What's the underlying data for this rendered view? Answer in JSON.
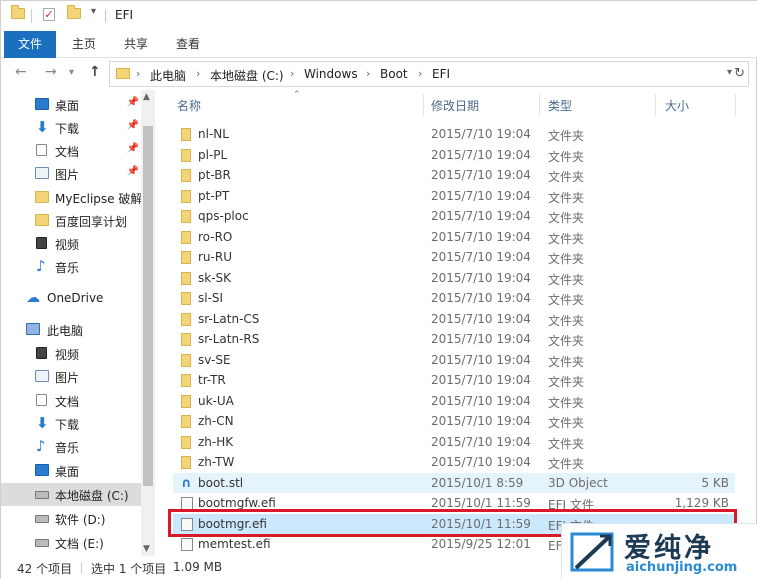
{
  "window": {
    "title": "EFI"
  },
  "ribbon": {
    "tabs": [
      {
        "label": "文件"
      },
      {
        "label": "主页"
      },
      {
        "label": "共享"
      },
      {
        "label": "查看"
      }
    ]
  },
  "address": {
    "crumbs": [
      "此电脑",
      "本地磁盘 (C:)",
      "Windows",
      "Boot",
      "EFI"
    ]
  },
  "navpane": {
    "items": [
      {
        "label": "桌面",
        "icon": "desktop-icon",
        "pinned": true
      },
      {
        "label": "下载",
        "icon": "download-icon",
        "pinned": true
      },
      {
        "label": "文档",
        "icon": "document-icon",
        "pinned": true
      },
      {
        "label": "图片",
        "icon": "pictures-icon",
        "pinned": true
      },
      {
        "label": "MyEclipse 破解",
        "icon": "folder-icon"
      },
      {
        "label": "百度回享计划",
        "icon": "folder-icon"
      },
      {
        "label": "视频",
        "icon": "video-icon"
      },
      {
        "label": "音乐",
        "icon": "music-icon"
      },
      {
        "label": "OneDrive",
        "icon": "onedrive-icon"
      },
      {
        "label": "此电脑",
        "icon": "this-pc-icon"
      },
      {
        "label": "视频",
        "icon": "video-icon"
      },
      {
        "label": "图片",
        "icon": "pictures-icon"
      },
      {
        "label": "文档",
        "icon": "document-icon"
      },
      {
        "label": "下载",
        "icon": "download-icon"
      },
      {
        "label": "音乐",
        "icon": "music-icon"
      },
      {
        "label": "桌面",
        "icon": "desktop-icon"
      },
      {
        "label": "本地磁盘 (C:)",
        "icon": "drive-icon",
        "selected": true
      },
      {
        "label": "软件 (D:)",
        "icon": "drive-icon"
      },
      {
        "label": "文档 (E:)",
        "icon": "drive-icon"
      }
    ]
  },
  "columns": {
    "name": "名称",
    "date": "修改日期",
    "type": "类型",
    "size": "大小"
  },
  "files": [
    {
      "name": "nl-NL",
      "date": "2015/7/10 19:04",
      "type": "文件夹",
      "size": "",
      "kind": "folder"
    },
    {
      "name": "pl-PL",
      "date": "2015/7/10 19:04",
      "type": "文件夹",
      "size": "",
      "kind": "folder"
    },
    {
      "name": "pt-BR",
      "date": "2015/7/10 19:04",
      "type": "文件夹",
      "size": "",
      "kind": "folder"
    },
    {
      "name": "pt-PT",
      "date": "2015/7/10 19:04",
      "type": "文件夹",
      "size": "",
      "kind": "folder"
    },
    {
      "name": "qps-ploc",
      "date": "2015/7/10 19:04",
      "type": "文件夹",
      "size": "",
      "kind": "folder"
    },
    {
      "name": "ro-RO",
      "date": "2015/7/10 19:04",
      "type": "文件夹",
      "size": "",
      "kind": "folder"
    },
    {
      "name": "ru-RU",
      "date": "2015/7/10 19:04",
      "type": "文件夹",
      "size": "",
      "kind": "folder"
    },
    {
      "name": "sk-SK",
      "date": "2015/7/10 19:04",
      "type": "文件夹",
      "size": "",
      "kind": "folder"
    },
    {
      "name": "sl-SI",
      "date": "2015/7/10 19:04",
      "type": "文件夹",
      "size": "",
      "kind": "folder"
    },
    {
      "name": "sr-Latn-CS",
      "date": "2015/7/10 19:04",
      "type": "文件夹",
      "size": "",
      "kind": "folder"
    },
    {
      "name": "sr-Latn-RS",
      "date": "2015/7/10 19:04",
      "type": "文件夹",
      "size": "",
      "kind": "folder"
    },
    {
      "name": "sv-SE",
      "date": "2015/7/10 19:04",
      "type": "文件夹",
      "size": "",
      "kind": "folder"
    },
    {
      "name": "tr-TR",
      "date": "2015/7/10 19:04",
      "type": "文件夹",
      "size": "",
      "kind": "folder"
    },
    {
      "name": "uk-UA",
      "date": "2015/7/10 19:04",
      "type": "文件夹",
      "size": "",
      "kind": "folder"
    },
    {
      "name": "zh-CN",
      "date": "2015/7/10 19:04",
      "type": "文件夹",
      "size": "",
      "kind": "folder"
    },
    {
      "name": "zh-HK",
      "date": "2015/7/10 19:04",
      "type": "文件夹",
      "size": "",
      "kind": "folder"
    },
    {
      "name": "zh-TW",
      "date": "2015/7/10 19:04",
      "type": "文件夹",
      "size": "",
      "kind": "folder"
    },
    {
      "name": "boot.stl",
      "date": "2015/10/1 8:59",
      "type": "3D Object",
      "size": "5 KB",
      "kind": "stl",
      "state": "hover"
    },
    {
      "name": "bootmgfw.efi",
      "date": "2015/10/1 11:59",
      "type": "EFI 文件",
      "size": "1,129 KB",
      "kind": "efi"
    },
    {
      "name": "bootmgr.efi",
      "date": "2015/10/1 11:59",
      "type": "EFI 文件",
      "size": "",
      "kind": "efi",
      "state": "selected"
    },
    {
      "name": "memtest.efi",
      "date": "2015/9/25 12:01",
      "type": "EFI 文件",
      "size": "",
      "kind": "efi"
    }
  ],
  "status": {
    "count": "42 个项目",
    "selection": "选中 1 个项目",
    "size": "1.09 MB"
  },
  "watermark": {
    "title": "爱纯净",
    "url": "aichunjing.com"
  },
  "colors": {
    "accent": "#1a6fbf",
    "highlight": "#d8192a",
    "selected_row": "#cce8ff"
  }
}
